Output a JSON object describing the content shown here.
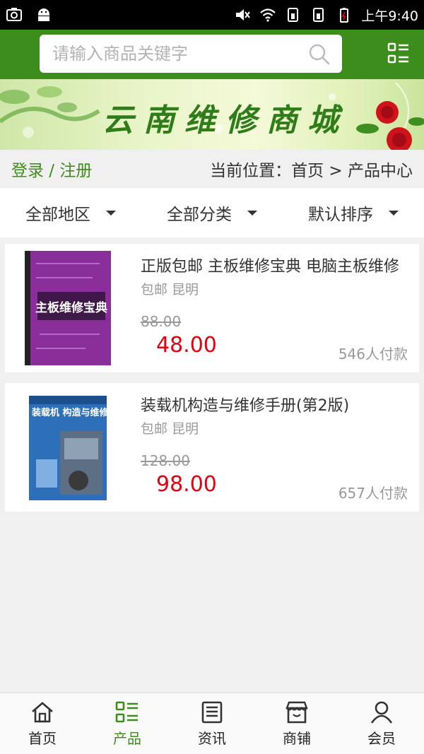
{
  "status_bar": {
    "time": "上午9:40"
  },
  "search": {
    "placeholder": "请输入商品关键字"
  },
  "banner": {
    "title": "云南维修商城"
  },
  "breadcrumb": {
    "login_register": "登录 / 注册",
    "location": "当前位置：首页 > 产品中心"
  },
  "filters": [
    {
      "label": "全部地区"
    },
    {
      "label": "全部分类"
    },
    {
      "label": "默认排序"
    }
  ],
  "products": [
    {
      "title": "正版包邮 主板维修宝典 电脑主板维修",
      "tags": "包邮 昆明",
      "original_price": "88.00",
      "price": "48.00",
      "paid": "546人付款",
      "cover_text": "主板维修宝典"
    },
    {
      "title": "装载机构造与维修手册(第2版)",
      "tags": "包邮 昆明",
      "original_price": "128.00",
      "price": "98.00",
      "paid": "657人付款",
      "cover_text": "装载机 构造与维修手册"
    }
  ],
  "nav": [
    {
      "label": "首页",
      "icon": "home-icon",
      "active": false
    },
    {
      "label": "产品",
      "icon": "product-list-icon",
      "active": true
    },
    {
      "label": "资讯",
      "icon": "news-icon",
      "active": false
    },
    {
      "label": "商铺",
      "icon": "shop-icon",
      "active": false
    },
    {
      "label": "会员",
      "icon": "member-icon",
      "active": false
    }
  ],
  "colors": {
    "brand_green": "#3d8d1c",
    "price_red": "#e60012"
  }
}
